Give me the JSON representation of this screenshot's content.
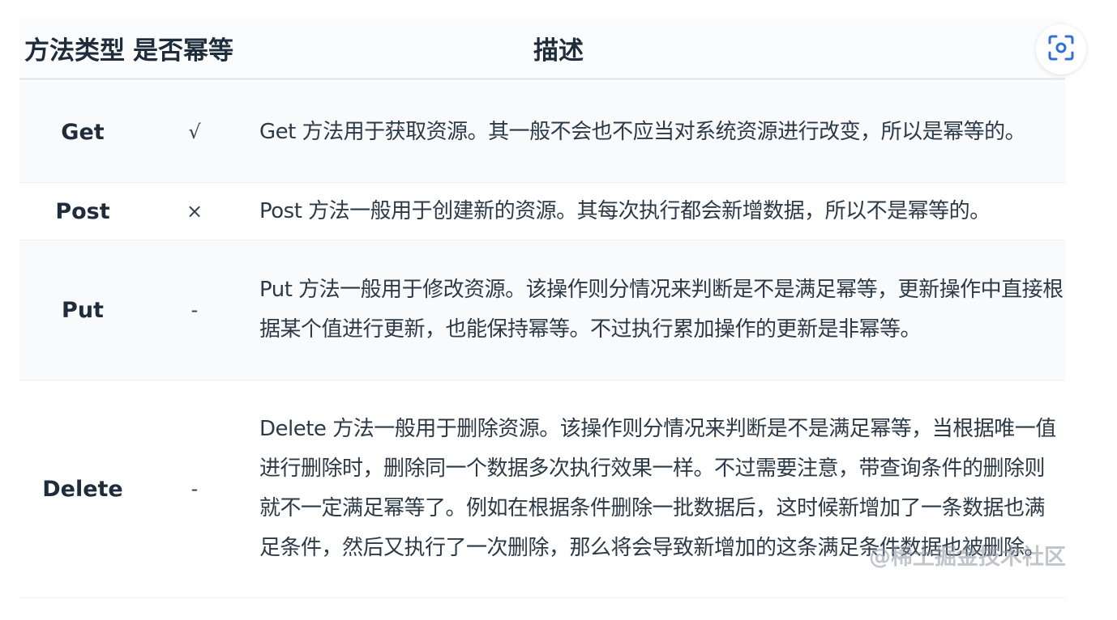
{
  "table": {
    "headers": {
      "method": "方法类型",
      "idempotent": "是否幂等",
      "description": "描述"
    },
    "rows": [
      {
        "method": "Get",
        "idempotent": "√",
        "description": "Get 方法用于获取资源。其一般不会也不应当对系统资源进行改变，所以是幂等的。"
      },
      {
        "method": "Post",
        "idempotent": "×",
        "description": "Post 方法一般用于创建新的资源。其每次执行都会新增数据，所以不是幂等的。"
      },
      {
        "method": "Put",
        "idempotent": "-",
        "description": "Put 方法一般用于修改资源。该操作则分情况来判断是不是满足幂等，更新操作中直接根据某个值进行更新，也能保持幂等。不过执行累加操作的更新是非幂等。"
      },
      {
        "method": "Delete",
        "idempotent": "-",
        "description": "Delete 方法一般用于删除资源。该操作则分情况来判断是不是满足幂等，当根据唯一值进行删除时，删除同一个数据多次执行效果一样。不过需要注意，带查询条件的删除则就不一定满足幂等了。例如在根据条件删除一批数据后，这时候新增加了一条数据也满足条件，然后又执行了一次删除，那么将会导致新增加的这条满足条件数据也被删除。"
      }
    ]
  },
  "watermark": "@稀土掘金技术社区",
  "icons": {
    "scan": "scan-icon"
  }
}
